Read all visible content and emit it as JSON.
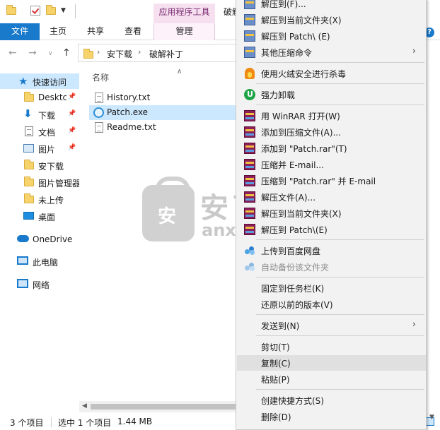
{
  "titlebar": {
    "contextual_tab": "应用程序工具",
    "title": "破解"
  },
  "ribbon": {
    "tabs": [
      "文件",
      "主页",
      "共享",
      "查看",
      "管理"
    ]
  },
  "address": {
    "crumbs": [
      "安下载",
      "破解补丁"
    ]
  },
  "navpane": {
    "items": [
      {
        "label": "快速访问",
        "icon": "star-icon"
      },
      {
        "label": "Desktc",
        "icon": "folder-icon",
        "pinned": true
      },
      {
        "label": "下载",
        "icon": "download-icon",
        "pinned": true
      },
      {
        "label": "文档",
        "icon": "document-icon",
        "pinned": true
      },
      {
        "label": "图片",
        "icon": "pictures-icon",
        "pinned": true
      },
      {
        "label": "安下载",
        "icon": "folder-icon"
      },
      {
        "label": "图片管理器",
        "icon": "folder-icon"
      },
      {
        "label": "未上传",
        "icon": "folder-icon"
      },
      {
        "label": "桌面",
        "icon": "desktop-icon"
      },
      {
        "label": "OneDrive",
        "icon": "onedrive-icon"
      },
      {
        "label": "此电脑",
        "icon": "this-pc-icon"
      },
      {
        "label": "网络",
        "icon": "network-icon"
      }
    ]
  },
  "filelist": {
    "column_header": "名称",
    "files": [
      {
        "name": "History.txt",
        "icon": "text-file-icon"
      },
      {
        "name": "Patch.exe",
        "icon": "exe-file-icon",
        "selected": true
      },
      {
        "name": "Readme.txt",
        "icon": "text-file-icon"
      }
    ]
  },
  "watermark": {
    "bag_text": "安",
    "big_text": "安下",
    "small_text": "anxz.com"
  },
  "statusbar": {
    "item_count": "3 个项目",
    "selection": "选中 1 个项目",
    "size": "1.44 MB"
  },
  "context_menu": {
    "items": [
      {
        "label": "解压到(F)...",
        "icon": "zip-icon"
      },
      {
        "label": "解压到当前文件夹(X)",
        "icon": "zip-icon"
      },
      {
        "label": "解压到 Patch\\ (E)",
        "icon": "zip-icon"
      },
      {
        "label": "其他压缩命令",
        "icon": "zip-icon",
        "submenu": true
      },
      {
        "label": "使用火绒安全进行杀毒",
        "icon": "huorong-icon"
      },
      {
        "label": "强力卸载",
        "icon": "uninstall-icon"
      },
      {
        "label": "用 WinRAR 打开(W)",
        "icon": "winrar-icon"
      },
      {
        "label": "添加到压缩文件(A)...",
        "icon": "winrar-icon"
      },
      {
        "label": "添加到 \"Patch.rar\"(T)",
        "icon": "winrar-icon"
      },
      {
        "label": "压缩并 E-mail...",
        "icon": "winrar-icon"
      },
      {
        "label": "压缩到 \"Patch.rar\" 并 E-mail",
        "icon": "winrar-icon"
      },
      {
        "label": "解压文件(A)...",
        "icon": "winrar-icon"
      },
      {
        "label": "解压到当前文件夹(X)",
        "icon": "winrar-icon"
      },
      {
        "label": "解压到 Patch\\(E)",
        "icon": "winrar-icon"
      },
      {
        "label": "上传到百度网盘",
        "icon": "baidu-netdisk-icon"
      },
      {
        "label": "自动备份该文件夹",
        "icon": "baidu-netdisk-icon",
        "disabled": true
      },
      {
        "label": "固定到任务栏(K)"
      },
      {
        "label": "还原以前的版本(V)"
      },
      {
        "label": "发送到(N)",
        "submenu": true
      },
      {
        "label": "剪切(T)"
      },
      {
        "label": "复制(C)",
        "hovered": true
      },
      {
        "label": "粘贴(P)"
      },
      {
        "label": "创建快捷方式(S)"
      },
      {
        "label": "删除(D)"
      }
    ]
  },
  "colors": {
    "accent": "#1979ca",
    "selection": "#cce8ff",
    "contextual_tab": "#f6e0f0",
    "menu_bg": "#f2f2f2",
    "menu_hover": "#e0e0e0"
  }
}
